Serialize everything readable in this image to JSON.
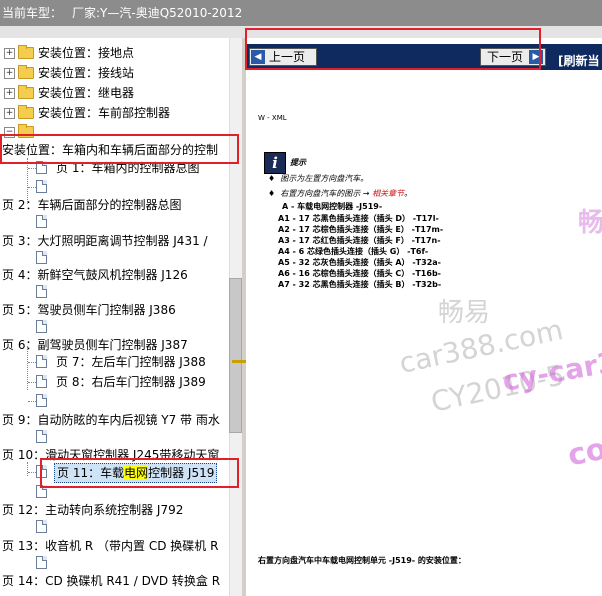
{
  "titlebar": {
    "prefix": "当前车型：",
    "car": "厂家:Y—汽-奥迪Q52010-2012"
  },
  "tree": {
    "folders": [
      {
        "label": "安装位置：接地点"
      },
      {
        "label": "安装位置：接线站"
      },
      {
        "label": "安装位置：继电器"
      },
      {
        "label": "安装位置：车前部控制器"
      }
    ],
    "open_folder_label": "安装位置：车箱内和车辆后面部分的控制",
    "pages": [
      {
        "label": "页 1：车箱内的控制器总图"
      },
      {
        "label": "页 2：车辆后面部分的控制器总图"
      },
      {
        "label": "页 3：大灯照明距离调节控制器 J431 /"
      },
      {
        "label": "页 4：新鲜空气鼓风机控制器 J126"
      },
      {
        "label": "页 5：驾驶员侧车门控制器 J386"
      },
      {
        "label": "页 6：副驾驶员侧车门控制器 J387"
      },
      {
        "label": "页 7：左后车门控制器 J388"
      },
      {
        "label": "页 8：右后车门控制器 J389"
      },
      {
        "label": "页 9：自动防眩的车内后视镜 Y7 带 雨水"
      },
      {
        "label": "页 10：滑动天窗控制器 J245带移动天窗"
      },
      {
        "label_pre": "页 11：车载",
        "label_hl": "电网",
        "label_post": "控制器 J519"
      },
      {
        "label": "页 12：主动转向系统控制器 J792"
      },
      {
        "label": "页 13：收音机 R （带内置 CD 换碟机 R"
      },
      {
        "label": "页 14：CD 换碟机 R41 / DVD 转换盒 R"
      }
    ]
  },
  "nav": {
    "prev_label": "上一页",
    "next_label": "下一页",
    "refresh_label": "[刷新当"
  },
  "doc": {
    "header": "W - XML",
    "hint_title": "提示",
    "bullet1": "图示为左置方向盘汽车。",
    "bullet2_pre": "右置方向盘汽车的图示 → ",
    "bullet2_link": "相关章节",
    "bullet2_post": "。",
    "controller_title": "A - 车载电网控制器 -J519-",
    "connectors": [
      {
        "code": "A1 - 17 芯黑色插头连接（插头 D）",
        "tag": "-T17l-"
      },
      {
        "code": "A2 - 17 芯棕色插头连接（插头 E）",
        "tag": "-T17m-"
      },
      {
        "code": "A3 - 17 芯红色插头连接（插头 F）",
        "tag": "-T17n-"
      },
      {
        "code": "A4 - 6 芯绿色插头连接（插头 G）",
        "tag": "-T6f-"
      },
      {
        "code": "A5 - 32 芯灰色插头连接（插头 A）",
        "tag": "-T32a-"
      },
      {
        "code": "A6 - 16 芯棕色插头连接（插头 C）",
        "tag": "-T16b-"
      },
      {
        "code": "A7 - 32 芯黑色插头连接（插头 B）",
        "tag": "-T32b-"
      }
    ],
    "footer": "右置方向盘汽车中车载电网控制单元 -J519- 的安装位置："
  },
  "watermarks": {
    "changyi": "畅易",
    "car388": "car388.com",
    "cy": "CY2010-5",
    "cycar": "cy-car3",
    "changyi_pink": "畅",
    "co_pink": "co"
  },
  "colors": {
    "highlight_box": "#e0202a",
    "selection": "#cfe3f7",
    "text_highlight": "#ffff00",
    "navbar": "#0f2a5e",
    "link_red": "#d01010"
  }
}
